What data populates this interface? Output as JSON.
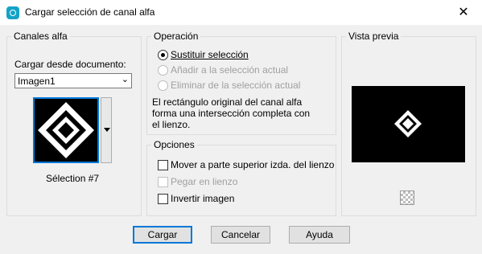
{
  "window": {
    "title": "Cargar selección de canal alfa",
    "close_glyph": "✕"
  },
  "canales": {
    "legend": "Canales alfa",
    "load_label": "Cargar desde documento:",
    "document_value": "Imagen1",
    "channel_name": "Sélection #7"
  },
  "operacion": {
    "legend": "Operación",
    "options": [
      "Sustituir selección",
      "Añadir a la selección actual",
      "Eliminar de la selección actual"
    ],
    "selected": "Sustituir selección",
    "description": [
      "El rectángulo original del canal alfa",
      "forma una intersección completa con",
      "el lienzo."
    ]
  },
  "opciones": {
    "legend": "Opciones",
    "items": [
      {
        "label": "Mover a parte superior izda. del lienzo",
        "checked": false,
        "enabled": true
      },
      {
        "label": "Pegar en lienzo",
        "checked": false,
        "enabled": false
      },
      {
        "label": "Invertir imagen",
        "checked": false,
        "enabled": true
      }
    ]
  },
  "preview": {
    "legend": "Vista previa"
  },
  "buttons": {
    "ok": "Cargar",
    "cancel": "Cancelar",
    "help": "Ayuda"
  },
  "colors": {
    "accent": "#0078d7",
    "title_icon": "#14a3c7"
  }
}
